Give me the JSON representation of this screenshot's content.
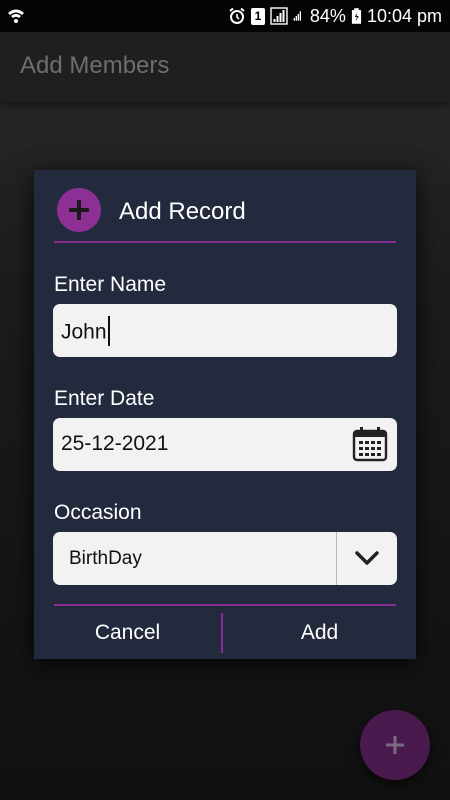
{
  "status_bar": {
    "battery": "84%",
    "time": "10:04 pm",
    "sim_label": "1"
  },
  "app_bar": {
    "title": "Add Members"
  },
  "dialog": {
    "title": "Add Record",
    "name_label": "Enter Name",
    "name_value": "John",
    "date_label": "Enter Date",
    "date_value": "25-12-2021",
    "occasion_label": "Occasion",
    "occasion_value": "BirthDay",
    "cancel_label": "Cancel",
    "add_label": "Add"
  },
  "colors": {
    "accent": "#8e2f95",
    "dialog_bg": "#232a3e",
    "field_bg": "#f2f2f2"
  },
  "icons": {
    "header": "plus-circle-icon",
    "date_field": "calendar-icon",
    "occasion_field": "chevron-down-icon",
    "fab": "plus-icon"
  }
}
